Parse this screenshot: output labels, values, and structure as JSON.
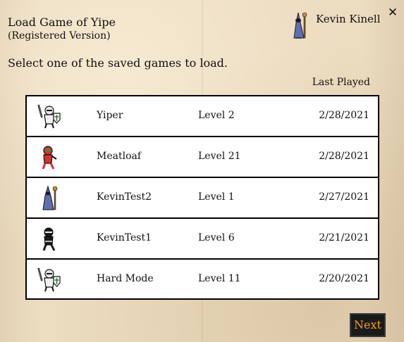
{
  "header": {
    "title": "Load Game of Yipe",
    "subtitle": "(Registered Version)",
    "instruction": "Select one of the saved games to load."
  },
  "user": {
    "name": "Kevin Kinell",
    "avatar_icon": "wizard-avatar-icon"
  },
  "close_label": "✕",
  "table": {
    "column_header": "Last Played",
    "rows": [
      {
        "icon": "knight-icon",
        "name": "Yiper",
        "level": "Level 2",
        "date": "2/28/2021"
      },
      {
        "icon": "red-ninja-icon",
        "name": "Meatloaf",
        "level": "Level 21",
        "date": "2/28/2021"
      },
      {
        "icon": "wizard-icon",
        "name": "KevinTest2",
        "level": "Level 1",
        "date": "2/27/2021"
      },
      {
        "icon": "black-ninja-icon",
        "name": "KevinTest1",
        "level": "Level 6",
        "date": "2/21/2021"
      },
      {
        "icon": "knight-icon",
        "name": "Hard Mode",
        "level": "Level 11",
        "date": "2/20/2021"
      }
    ]
  },
  "next_label": "Next",
  "colors": {
    "next_text": "#f0a020",
    "next_bg": "#1a1a1a",
    "background": "#ecdcc0"
  }
}
